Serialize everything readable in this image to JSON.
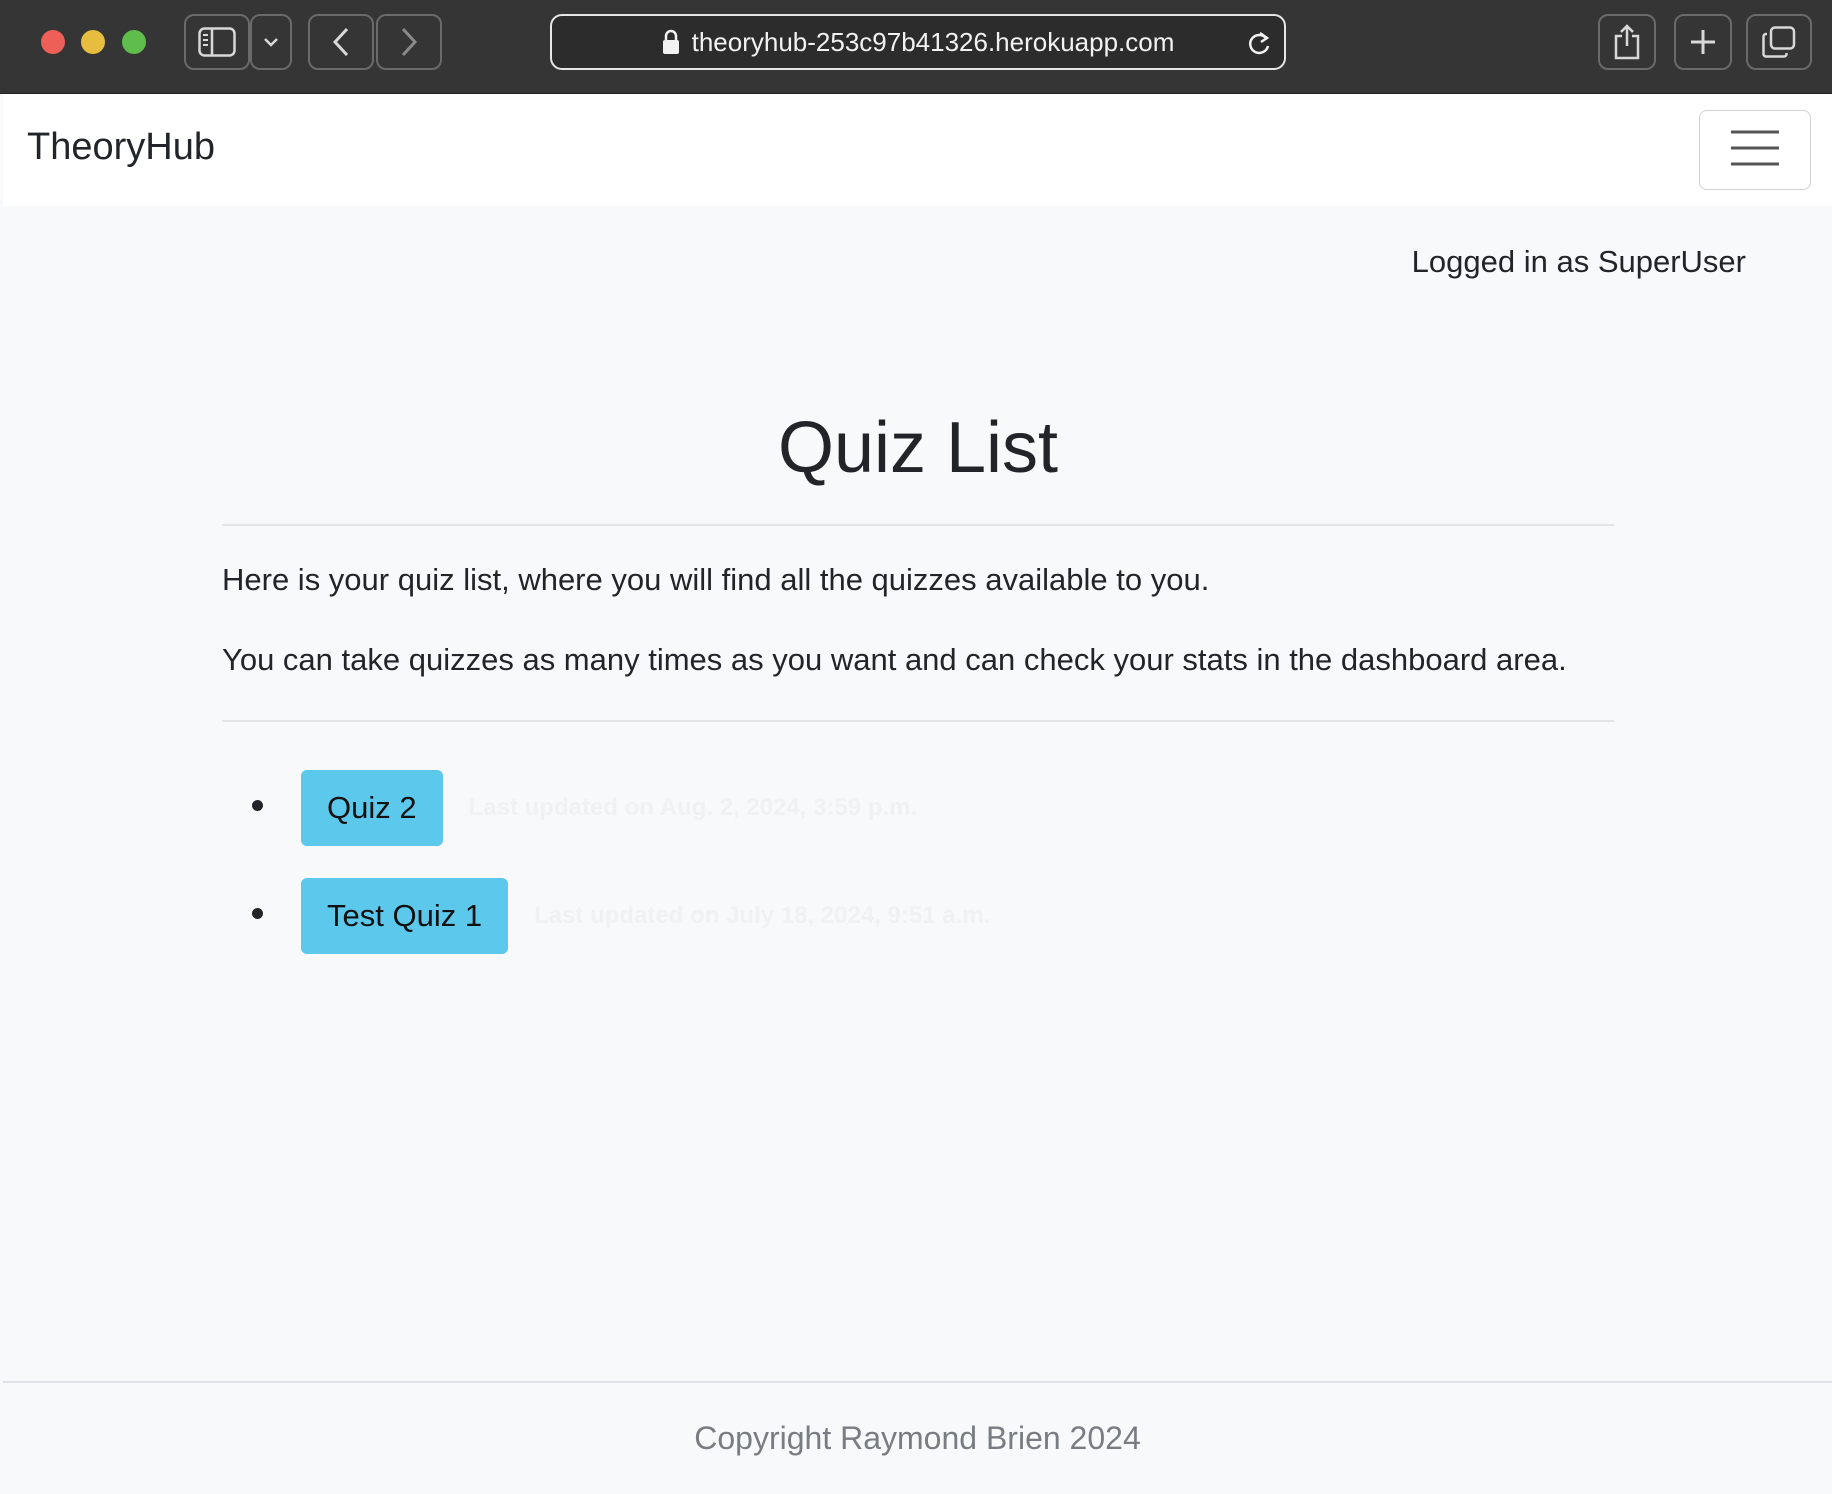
{
  "browser": {
    "url": "theoryhub-253c97b41326.herokuapp.com"
  },
  "navbar": {
    "brand": "TheoryHub"
  },
  "user": {
    "status": "Logged in as SuperUser"
  },
  "main": {
    "title": "Quiz List",
    "intro": "Here is your quiz list, where you will find all the quizzes available to you.",
    "note": "You can take quizzes as many times as you want and can check your stats in the dashboard area.",
    "quizzes": [
      {
        "label": "Quiz 2",
        "updated": "Last updated on Aug. 2, 2024, 3:59 p.m."
      },
      {
        "label": "Test Quiz 1",
        "updated": "Last updated on July 18, 2024, 9:51 a.m."
      }
    ]
  },
  "footer": {
    "copyright": "Copyright Raymond Brien 2024"
  },
  "colors": {
    "accent": "#5bc8ec",
    "chrome": "#353535",
    "page_bg": "#f8f9fa"
  }
}
